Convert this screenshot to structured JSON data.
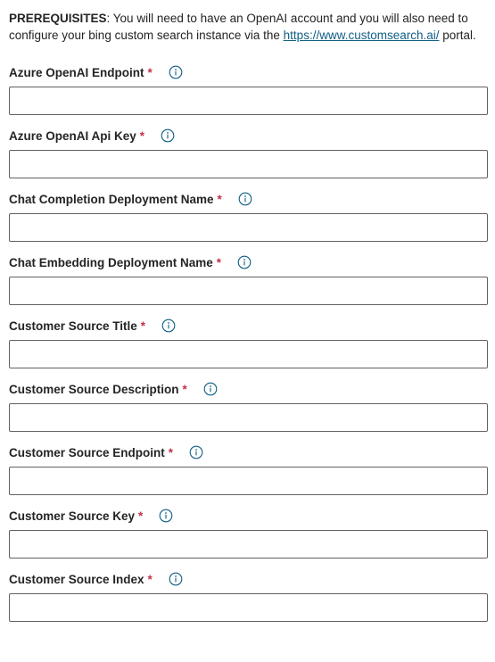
{
  "prerequisites": {
    "heading": "PREREQUISITES",
    "text_before_link": ": You will need to have an OpenAI account and you will also need to configure your bing custom search instance via the ",
    "link_text": "https://www.customsearch.ai/",
    "text_after_link": " portal."
  },
  "required_marker": "*",
  "info_icon": "info-circle-icon",
  "colors": {
    "required": "#c4314b",
    "link": "#0f5e84",
    "info_icon": "#0f5e84",
    "border": "#616161"
  },
  "fields": [
    {
      "label": "Azure OpenAI Endpoint",
      "value": ""
    },
    {
      "label": "Azure OpenAI Api Key",
      "value": ""
    },
    {
      "label": "Chat Completion Deployment Name",
      "value": ""
    },
    {
      "label": "Chat Embedding Deployment Name",
      "value": ""
    },
    {
      "label": "Customer Source Title",
      "value": ""
    },
    {
      "label": "Customer Source Description",
      "value": ""
    },
    {
      "label": "Customer Source Endpoint",
      "value": ""
    },
    {
      "label": "Customer Source Key",
      "value": ""
    },
    {
      "label": "Customer Source Index",
      "value": ""
    }
  ]
}
